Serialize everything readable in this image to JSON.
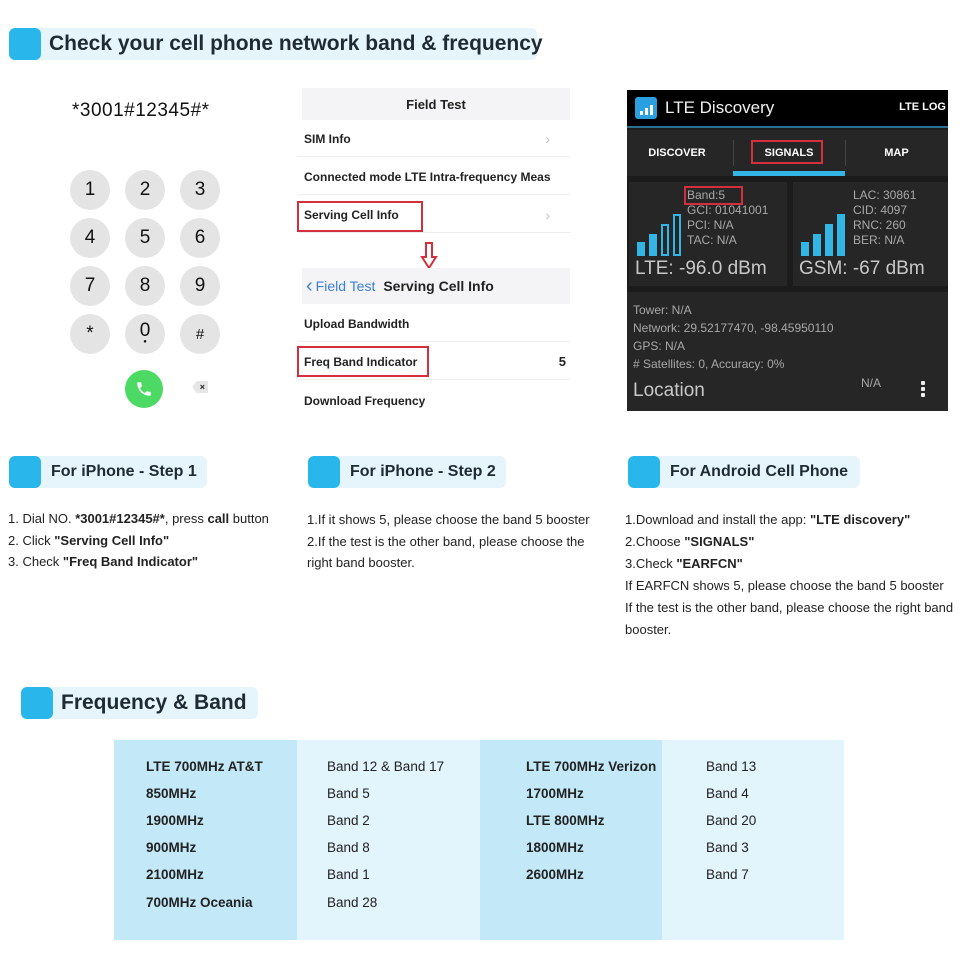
{
  "header": {
    "title": "Check your cell phone network band & frequency"
  },
  "dialer": {
    "number": "*3001#12345#*",
    "keys": [
      "1",
      "2",
      "3",
      "4",
      "5",
      "6",
      "7",
      "8",
      "9",
      "*",
      "0",
      "#"
    ],
    "zero_sub": "+",
    "delete_glyph": "×",
    "call_icon": "phone-icon"
  },
  "field_test": {
    "title": "Field Test",
    "rows": [
      {
        "label": "SIM Info",
        "chevron": "›"
      },
      {
        "label": "Connected mode LTE Intra-frequency Meas"
      },
      {
        "label": "Serving Cell Info",
        "chevron": "›",
        "highlighted": true
      }
    ],
    "nav": {
      "back_label": "Field Test",
      "back_glyph": "‹",
      "title": "Serving Cell Info"
    },
    "detail_rows": [
      {
        "label": "Upload Bandwidth"
      },
      {
        "label": "Freq Band Indicator",
        "value": "5",
        "highlighted": true
      },
      {
        "label": "Download Frequency"
      }
    ],
    "arrow_color": "#d32f3c"
  },
  "lte_app": {
    "title": "LTE Discovery",
    "overflow_label": "LTE LOG",
    "tabs": [
      {
        "label": "DISCOVER"
      },
      {
        "label": "SIGNALS",
        "active": true,
        "highlighted": true
      },
      {
        "label": "MAP"
      }
    ],
    "lte_card": {
      "lines": [
        "Band:5",
        "GCI: 01041001",
        "PCI: N/A",
        "TAC: N/A"
      ],
      "reading": "LTE: -96.0 dBm"
    },
    "gsm_card": {
      "lines": [
        "LAC: 30861",
        "CID: 4097",
        "RNC: 260",
        "BER: N/A"
      ],
      "reading": "GSM: -67 dBm"
    },
    "location": {
      "lines": [
        "Tower: N/A",
        "Network: 29.52177470, -98.45950110",
        "GPS: N/A",
        "# Satellites: 0, Accuracy: 0%"
      ],
      "title": "Location",
      "status": "N/A"
    },
    "accent": "#33b5e5"
  },
  "iphone_step1": {
    "title": "For iPhone - Step 1",
    "lines": [
      {
        "pre": "1. Dial NO. ",
        "bold": "*3001#12345#*",
        "mid": ", press ",
        "bold2": "call",
        "post": " button"
      },
      {
        "pre": "2. Click ",
        "bold": "\"Serving Cell Info\""
      },
      {
        "pre": "3. Check ",
        "bold": "\"Freq Band Indicator\""
      }
    ]
  },
  "iphone_step2": {
    "title": "For iPhone - Step 2",
    "lines": [
      "1.If it shows 5, please choose the band  5 booster",
      "2.If the test is the other band, please choose the",
      "right band booster."
    ]
  },
  "android": {
    "title": "For Android Cell Phone",
    "lines": [
      {
        "pre": "1.Download and install the app: ",
        "bold": "\"LTE discovery\""
      },
      {
        "pre": "2.Choose ",
        "bold": "\"SIGNALS\""
      },
      {
        "pre": "3.Check ",
        "bold": "\"EARFCN\""
      },
      {
        "pre": "If EARFCN  shows 5, please choose the band 5 booster"
      },
      {
        "pre": "If the test is the other band, please choose the right band"
      },
      {
        "pre": "booster."
      }
    ]
  },
  "frequency_band": {
    "title": "Frequency & Band",
    "left": [
      {
        "freq": "LTE  700MHz  AT&T",
        "band": "Band 12 & Band 17"
      },
      {
        "freq": "850MHz",
        "band": "Band 5"
      },
      {
        "freq": "1900MHz",
        "band": "Band 2"
      },
      {
        "freq": "900MHz",
        "band": "Band 8"
      },
      {
        "freq": "2100MHz",
        "band": "Band 1"
      },
      {
        "freq": "700MHz Oceania",
        "band": "Band 28"
      }
    ],
    "right": [
      {
        "freq": "LTE  700MHz  Verizon",
        "band": "Band 13"
      },
      {
        "freq": "1700MHz",
        "band": "Band 4"
      },
      {
        "freq": "LTE  800MHz",
        "band": "Band 20"
      },
      {
        "freq": "1800MHz",
        "band": "Band 3"
      },
      {
        "freq": "2600MHz",
        "band": "Band 7"
      }
    ]
  },
  "colors": {
    "accent_blue": "#29b6ea",
    "header_bg": "#e6f5fc",
    "highlight_red": "#d32f3c",
    "call_green": "#4cd964",
    "table_dark": "#c3e9f8",
    "table_light": "#e2f4fc"
  }
}
